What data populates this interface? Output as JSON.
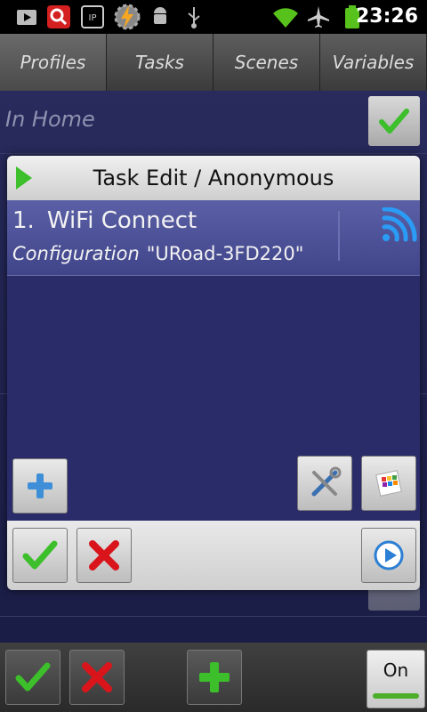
{
  "status_bar": {
    "time": "23:26",
    "icons": [
      "youtube-icon",
      "search-icon",
      "voicemail-icon",
      "tasker-icon",
      "android-icon",
      "usb-icon",
      "wifi-icon",
      "airplane-icon",
      "battery-icon"
    ]
  },
  "tabs": [
    "Profiles",
    "Tasks",
    "Scenes",
    "Variables"
  ],
  "background": {
    "profile_name": "In Home"
  },
  "dialog": {
    "title": "Task Edit / Anonymous",
    "action": {
      "number": "1.",
      "name": "WiFi Connect",
      "config_label": "Configuration",
      "config_value": "\"URoad-3FD220\""
    },
    "buttons": {
      "add": "plus-icon",
      "settings": "tools-icon",
      "icon_picker": "palette-icon",
      "accept": "check-icon",
      "cancel": "cross-icon",
      "play": "play-icon"
    }
  },
  "bottom_bar": {
    "on_label": "On"
  },
  "colors": {
    "accent_green": "#3cbf2a",
    "cancel_red": "#d9151b",
    "wifi_blue": "#2b9cf5"
  }
}
